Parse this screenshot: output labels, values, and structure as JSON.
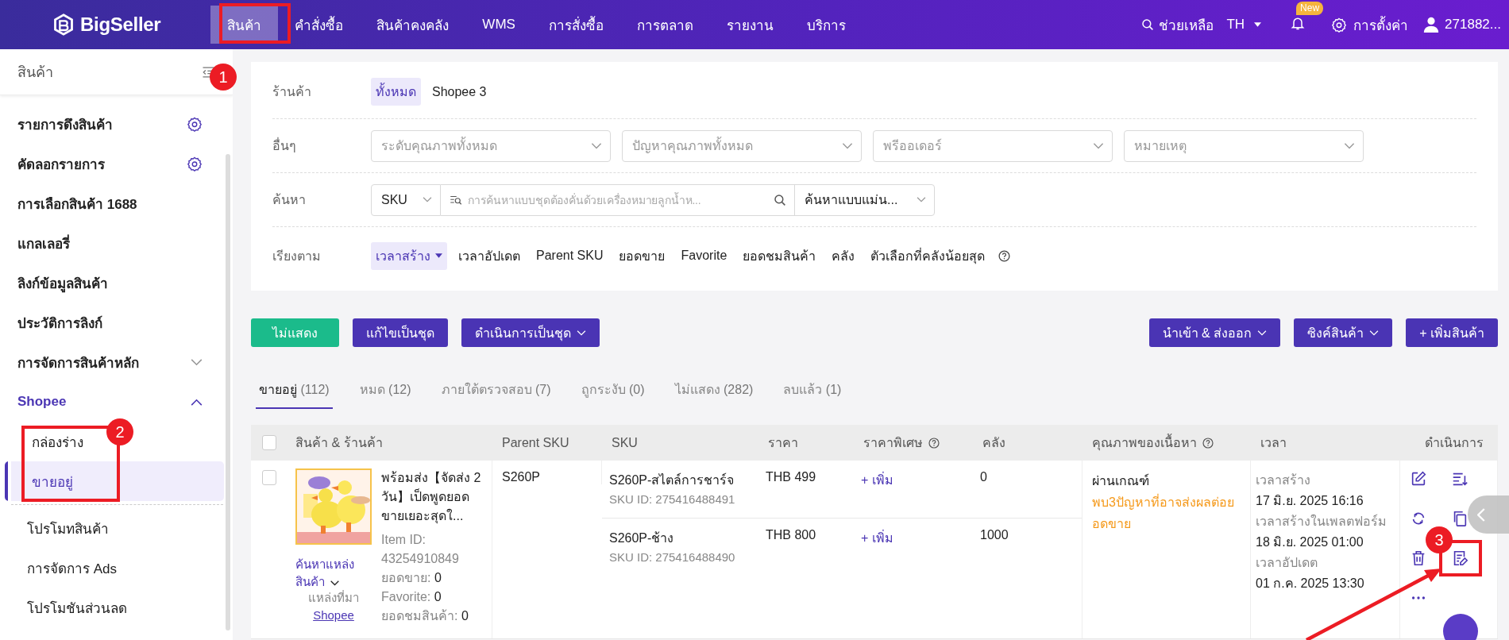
{
  "top_nav": {
    "logo": "BigSeller",
    "items": [
      {
        "label": "สินค้า",
        "selected": true
      },
      {
        "label": "คำสั่งซื้อ",
        "selected": false
      },
      {
        "label": "สินค้าคงคลัง",
        "selected": false
      },
      {
        "label": "WMS",
        "selected": false
      },
      {
        "label": "การสั่งซื้อ",
        "selected": false
      },
      {
        "label": "การตลาด",
        "selected": false
      },
      {
        "label": "รายงาน",
        "selected": false
      },
      {
        "label": "บริการ",
        "selected": false
      }
    ],
    "help": "ช่วยเหลือ",
    "language": "TH",
    "new_badge": "New",
    "settings": "การตั้งค่า",
    "account": "271882..."
  },
  "sidebar": {
    "title": "สินค้า",
    "items": [
      {
        "label": "รายการดึงสินค้า",
        "kind": "configurable"
      },
      {
        "label": "คัดลอกรายการ",
        "kind": "configurable"
      },
      {
        "label": "การเลือกสินค้า 1688",
        "kind": "link"
      },
      {
        "label": "แกลเลอรี่",
        "kind": "link"
      },
      {
        "label": "ลิงก์ข้อมูลสินค้า",
        "kind": "link"
      },
      {
        "label": "ประวัติการลิงก์",
        "kind": "link"
      },
      {
        "label": "การจัดการสินค้าหลัก",
        "kind": "group",
        "expanded": false
      },
      {
        "label": "Shopee",
        "kind": "group",
        "expanded": true,
        "children": [
          {
            "label": "กล่องร่าง",
            "kind": "page",
            "selected": false
          },
          {
            "label": "ขายอยู่",
            "kind": "page",
            "selected": true
          },
          {
            "label": "โปรโมทสินค้า",
            "kind": "tool",
            "selected": false
          },
          {
            "label": "การจัดการ Ads",
            "kind": "tool",
            "selected": false
          },
          {
            "label": "โปรโมชันส่วนลด",
            "kind": "tool",
            "selected": false
          }
        ]
      }
    ]
  },
  "filters": [
    {
      "label": "ร้านค้า",
      "kind": "chips",
      "options": [
        {
          "label": "ทั้งหมด",
          "selected": true
        },
        {
          "label": "Shopee 3",
          "selected": false
        }
      ]
    },
    {
      "label": "อื่นๆ",
      "kind": "selects",
      "selects": [
        {
          "placeholder": "ระดับคุณภาพทั้งหมด"
        },
        {
          "placeholder": "ปัญหาคุณภาพทั้งหมด"
        },
        {
          "placeholder": "พรีออเดอร์"
        },
        {
          "placeholder": "หมายเหตุ"
        }
      ]
    },
    {
      "label": "ค้นหา",
      "kind": "search",
      "field_type": "SKU",
      "placeholder": "การค้นหาแบบชุดต้องคั่นด้วยเครื่องหมายลูกน้ำห...",
      "mode": "ค้นหาแบบแม่น..."
    },
    {
      "label": "เรียงตาม",
      "kind": "sort",
      "help": true,
      "options": [
        {
          "label": "เวลาสร้าง",
          "selected": true
        },
        {
          "label": "เวลาอัปเดต",
          "selected": false
        },
        {
          "label": "Parent SKU",
          "selected": false
        },
        {
          "label": "ยอดขาย",
          "selected": false
        },
        {
          "label": "Favorite",
          "selected": false
        },
        {
          "label": "ยอดชมสินค้า",
          "selected": false
        },
        {
          "label": "คลัง",
          "selected": false
        },
        {
          "label": "ตัวเลือกที่คลังน้อยสุด",
          "selected": false
        }
      ]
    }
  ],
  "actions_left": [
    {
      "label": "ไม่แสดง",
      "kind": "success",
      "dropdown": false
    },
    {
      "label": "แก้ไขเป็นชุด",
      "kind": "primary",
      "dropdown": false
    },
    {
      "label": "ดำเนินการเป็นชุด",
      "kind": "primary",
      "dropdown": true
    }
  ],
  "actions_right": [
    {
      "label": "นำเข้า & ส่งออก",
      "kind": "primary",
      "dropdown": true
    },
    {
      "label": "ซิงค์สินค้า",
      "kind": "primary",
      "dropdown": true
    },
    {
      "label": "+ เพิ่มสินค้า",
      "kind": "primary",
      "dropdown": false
    }
  ],
  "tabs": [
    {
      "label": "ขายอยู่",
      "count": "(112)",
      "selected": true
    },
    {
      "label": "หมด",
      "count": "(12)",
      "selected": false
    },
    {
      "label": "ภายใต้ตรวจสอบ",
      "count": "(7)",
      "selected": false
    },
    {
      "label": "ถูกระงับ",
      "count": "(0)",
      "selected": false
    },
    {
      "label": "ไม่แสดง",
      "count": "(282)",
      "selected": false
    },
    {
      "label": "ลบแล้ว",
      "count": "(1)",
      "selected": false
    }
  ],
  "table": {
    "select_all": {
      "checked": false
    },
    "columns": [
      {
        "label": "สินค้า & ร้านค้า",
        "help": false
      },
      {
        "label": "Parent SKU",
        "help": false
      },
      {
        "label": "SKU",
        "help": false
      },
      {
        "label": "ราคา",
        "help": false
      },
      {
        "label": "ราคาพิเศษ",
        "help": true
      },
      {
        "label": "คลัง",
        "help": false
      },
      {
        "label": "คุณภาพของเนื้อหา",
        "help": true
      },
      {
        "label": "เวลา",
        "help": false
      },
      {
        "label": "ดำเนินการ",
        "help": false
      }
    ],
    "rows": [
      {
        "checked": false,
        "image": {
          "kind": "picture"
        },
        "title": "พร้อมส่ง【จัดส่ง 2 วัน】เป็ดพูดยอดขายเยอะสุดใ...",
        "item_id": "Item ID: 43254910849",
        "stats": [
          {
            "label": "ยอดขาย:",
            "value": "0"
          },
          {
            "label": "Favorite:",
            "value": "0"
          },
          {
            "label": "ยอดชมสินค้า:",
            "value": "0"
          }
        ],
        "source_search": "ค้นหาแหล่งสินค้า",
        "source_label": "แหล่งที่มา",
        "source_link": "Shopee",
        "parent_sku": "S260P",
        "variants": [
          {
            "sku": "S260P-สไตล์การชาร์จ",
            "sku_id": "SKU ID: 275416488491",
            "price": "THB 499",
            "special_price": "+ เพิ่ม",
            "stock": "0"
          },
          {
            "sku": "S260P-ช้าง",
            "sku_id": "SKU ID: 275416488490",
            "price": "THB 800",
            "special_price": "+ เพิ่ม",
            "stock": "1000"
          }
        ],
        "quality": "ผ่านเกณฑ์",
        "quality_issue": "พบ3ปัญหาที่อาจส่งผลต่อยอดขาย",
        "times": [
          {
            "label": "เวลาสร้าง",
            "value": "17 มิ.ย. 2025 16:16"
          },
          {
            "label": "เวลาสร้างในเพลตฟอร์ม",
            "value": "18 มิ.ย. 2025 01:00"
          },
          {
            "label": "เวลาอัปเดต",
            "value": "01 ก.ค. 2025 13:30"
          }
        ],
        "actions": [
          {
            "kind": "edit"
          },
          {
            "kind": "sort"
          },
          {
            "kind": "sync"
          },
          {
            "kind": "copy"
          },
          {
            "kind": "delete"
          },
          {
            "kind": "note"
          },
          {
            "kind": "more"
          }
        ]
      }
    ]
  },
  "annotations": [
    {
      "label": "1"
    },
    {
      "label": "2"
    },
    {
      "label": "3"
    }
  ]
}
